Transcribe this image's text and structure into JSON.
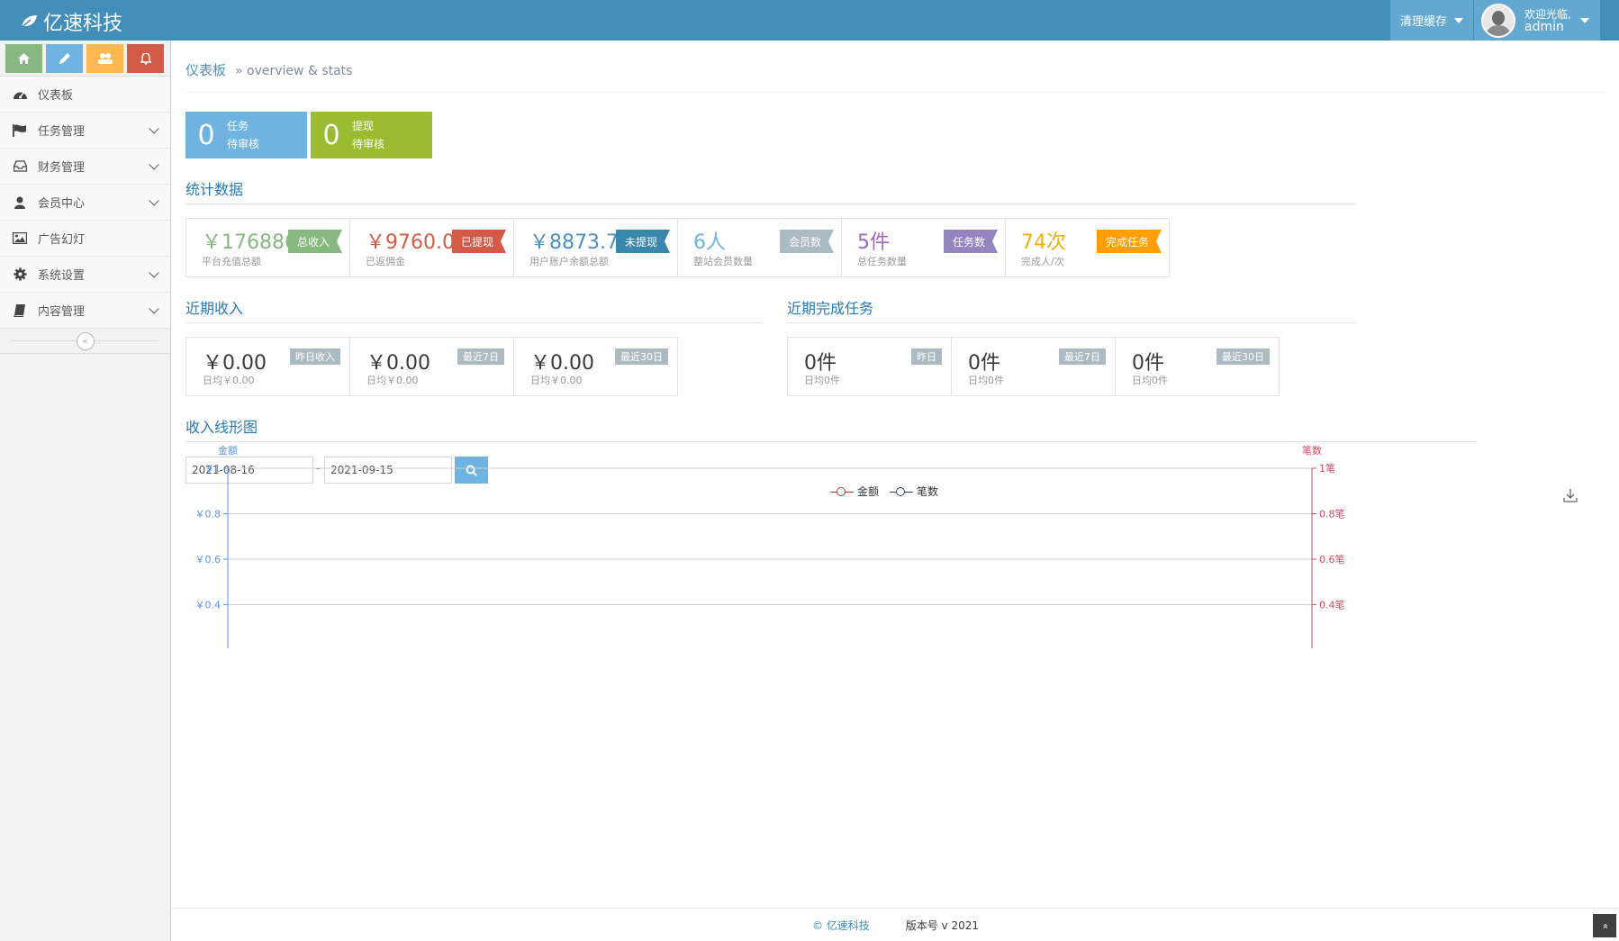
{
  "header": {
    "brand": "亿速科技",
    "clear_cache": "清理缓存",
    "welcome": "欢迎光临,",
    "username": "admin"
  },
  "sidebar": {
    "items": [
      {
        "label": "仪表板",
        "icon": "dashboard-icon",
        "expandable": false
      },
      {
        "label": "任务管理",
        "icon": "flag-icon",
        "expandable": true
      },
      {
        "label": "财务管理",
        "icon": "inbox-icon",
        "expandable": true
      },
      {
        "label": "会员中心",
        "icon": "user-icon",
        "expandable": true
      },
      {
        "label": "广告幻灯",
        "icon": "picture-icon",
        "expandable": false
      },
      {
        "label": "系统设置",
        "icon": "cog-icon",
        "expandable": true
      },
      {
        "label": "内容管理",
        "icon": "book-icon",
        "expandable": true
      }
    ],
    "collapse_glyph": "«"
  },
  "breadcrumb": {
    "title": "仪表板",
    "sub": "» overview & stats"
  },
  "pending": [
    {
      "num": "0",
      "line1": "任务",
      "line2": "待审核"
    },
    {
      "num": "0",
      "line1": "提现",
      "line2": "待审核"
    }
  ],
  "stats_title": "统计数据",
  "stats": [
    {
      "value": "￥176886.0",
      "desc": "平台充值总额",
      "tag": "总收入",
      "color": "#87b87f",
      "tagcolor": "#87b87f"
    },
    {
      "value": "￥9760.00",
      "desc": "已返佣金",
      "tag": "已提现",
      "color": "#d15b47",
      "tagcolor": "#d15b47"
    },
    {
      "value": "￥8873.73",
      "desc": "用户账户余额总额",
      "tag": "未提现",
      "color": "#4c8fbd",
      "tagcolor": "#3a87ad"
    },
    {
      "value": "6人",
      "desc": "整站会员数量",
      "tag": "会员数",
      "color": "#6fb3e0",
      "tagcolor": "#abbac3"
    },
    {
      "value": "5件",
      "desc": "总任务数量",
      "tag": "任务数",
      "color": "#a069c3",
      "tagcolor": "#9585bf"
    },
    {
      "value": "74次",
      "desc": "完成人/次",
      "tag": "完成任务",
      "color": "#e8b110",
      "tagcolor": "#ff9e08"
    }
  ],
  "recent_income": {
    "title": "近期收入",
    "items": [
      {
        "value": "￥0.00",
        "desc": "日均￥0.00",
        "tag": "昨日收入"
      },
      {
        "value": "￥0.00",
        "desc": "日均￥0.00",
        "tag": "最近7日"
      },
      {
        "value": "￥0.00",
        "desc": "日均￥0.00",
        "tag": "最近30日"
      }
    ]
  },
  "recent_tasks": {
    "title": "近期完成任务",
    "items": [
      {
        "value": "0件",
        "desc": "日均0件",
        "tag": "昨日"
      },
      {
        "value": "0件",
        "desc": "日均0件",
        "tag": "最近7日"
      },
      {
        "value": "0件",
        "desc": "日均0件",
        "tag": "最近30日"
      }
    ]
  },
  "chart_section": {
    "title": "收入线形图",
    "date_from": "2021-08-16",
    "date_sep": "-",
    "date_to": "2021-09-15"
  },
  "chart_data": {
    "type": "line",
    "series": [
      {
        "name": "金额",
        "color": "#c23531",
        "values": []
      },
      {
        "name": "笔数",
        "color": "#2f4554",
        "values": []
      }
    ],
    "y_left": {
      "label": "金额",
      "ticks": [
        "￥1",
        "￥0.8",
        "￥0.6",
        "￥0.4"
      ],
      "tick_values": [
        1,
        0.8,
        0.6,
        0.4
      ],
      "color": "#5793f3"
    },
    "y_right": {
      "label": "笔数",
      "ticks": [
        "1笔",
        "0.8笔",
        "0.6笔",
        "0.4笔"
      ],
      "tick_values": [
        1,
        0.8,
        0.6,
        0.4
      ],
      "color": "#d14a61"
    },
    "grid": true,
    "legend": "top-center"
  },
  "footer": {
    "copyright": "© 亿速科技",
    "version": "版本号 v 2021"
  },
  "to_top_glyph": "»"
}
